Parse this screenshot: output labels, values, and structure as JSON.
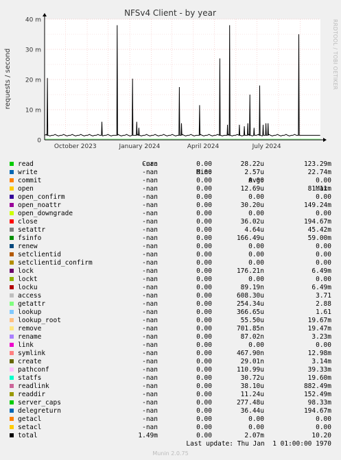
{
  "chart_data": {
    "type": "line",
    "title": "NFSv4 Client - by year",
    "ylabel": "requests / second",
    "ylim": [
      0,
      40
    ],
    "y_unit": "m",
    "yticks": [
      0,
      10,
      20,
      30,
      40
    ],
    "ytick_labels": [
      "0",
      "10 m",
      "20 m",
      "30 m",
      "40 m"
    ],
    "xlim": [
      "2023-09-01",
      "2024-09-30"
    ],
    "xtick_labels": [
      {
        "label": "October 2023",
        "date": "2023-10-15"
      },
      {
        "label": "January 2024",
        "date": "2024-01-15"
      },
      {
        "label": "April 2024",
        "date": "2024-04-15"
      },
      {
        "label": "July 2024",
        "date": "2024-07-15"
      }
    ],
    "grid": true,
    "series": [
      {
        "name": "total",
        "color": "#000000",
        "baseline": 1.5,
        "spikes": [
          {
            "x": "2023-09-05",
            "y": 20.5
          },
          {
            "x": "2023-11-22",
            "y": 6
          },
          {
            "x": "2023-12-14",
            "y": 38
          },
          {
            "x": "2024-01-05",
            "y": 20.3
          },
          {
            "x": "2024-01-11",
            "y": 6
          },
          {
            "x": "2024-01-14",
            "y": 4
          },
          {
            "x": "2024-03-12",
            "y": 17.5
          },
          {
            "x": "2024-03-15",
            "y": 5.5
          },
          {
            "x": "2024-04-10",
            "y": 11.5
          },
          {
            "x": "2024-05-09",
            "y": 27
          },
          {
            "x": "2024-05-20",
            "y": 5
          },
          {
            "x": "2024-05-23",
            "y": 38
          },
          {
            "x": "2024-06-06",
            "y": 5
          },
          {
            "x": "2024-06-13",
            "y": 4.5
          },
          {
            "x": "2024-06-18",
            "y": 5.5
          },
          {
            "x": "2024-06-21",
            "y": 15
          },
          {
            "x": "2024-06-27",
            "y": 4
          },
          {
            "x": "2024-07-05",
            "y": 18
          },
          {
            "x": "2024-07-10",
            "y": 5
          },
          {
            "x": "2024-07-14",
            "y": 5.5
          },
          {
            "x": "2024-07-17",
            "y": 5.5
          },
          {
            "x": "2024-08-30",
            "y": 35
          }
        ]
      }
    ]
  },
  "legend": {
    "headers": {
      "cur": "Cur:",
      "min": "Min:",
      "avg": "Avg:",
      "max": "Max:"
    },
    "rows": [
      {
        "name": "read",
        "color": "#00cc00",
        "cur": "-nan",
        "min": "0.00",
        "avg": "28.22u",
        "max": "123.29m"
      },
      {
        "name": "write",
        "color": "#0066b3",
        "cur": "-nan",
        "min": "0.00",
        "avg": "2.57u",
        "max": "22.74m"
      },
      {
        "name": "commit",
        "color": "#ff8000",
        "cur": "-nan",
        "min": "0.00",
        "avg": "0.00",
        "max": "0.00"
      },
      {
        "name": "open",
        "color": "#ffcc00",
        "cur": "-nan",
        "min": "0.00",
        "avg": "12.69u",
        "max": "81.11m"
      },
      {
        "name": "open_confirm",
        "color": "#330099",
        "cur": "-nan",
        "min": "0.00",
        "avg": "0.00",
        "max": "0.00"
      },
      {
        "name": "open_noattr",
        "color": "#990099",
        "cur": "-nan",
        "min": "0.00",
        "avg": "30.20u",
        "max": "149.24m"
      },
      {
        "name": "open_downgrade",
        "color": "#ccff00",
        "cur": "-nan",
        "min": "0.00",
        "avg": "0.00",
        "max": "0.00"
      },
      {
        "name": "close",
        "color": "#ff0000",
        "cur": "-nan",
        "min": "0.00",
        "avg": "36.02u",
        "max": "194.67m"
      },
      {
        "name": "setattr",
        "color": "#808080",
        "cur": "-nan",
        "min": "0.00",
        "avg": "4.64u",
        "max": "45.42m"
      },
      {
        "name": "fsinfo",
        "color": "#008f00",
        "cur": "-nan",
        "min": "0.00",
        "avg": "166.49u",
        "max": "59.00m"
      },
      {
        "name": "renew",
        "color": "#00487d",
        "cur": "-nan",
        "min": "0.00",
        "avg": "0.00",
        "max": "0.00"
      },
      {
        "name": "setclientid",
        "color": "#b35a00",
        "cur": "-nan",
        "min": "0.00",
        "avg": "0.00",
        "max": "0.00"
      },
      {
        "name": "setclientid_confirm",
        "color": "#b38f00",
        "cur": "-nan",
        "min": "0.00",
        "avg": "0.00",
        "max": "0.00"
      },
      {
        "name": "lock",
        "color": "#6b006b",
        "cur": "-nan",
        "min": "0.00",
        "avg": "176.21n",
        "max": "6.49m"
      },
      {
        "name": "lockt",
        "color": "#8fb300",
        "cur": "-nan",
        "min": "0.00",
        "avg": "0.00",
        "max": "0.00"
      },
      {
        "name": "locku",
        "color": "#b30000",
        "cur": "-nan",
        "min": "0.00",
        "avg": "89.19n",
        "max": "6.49m"
      },
      {
        "name": "access",
        "color": "#bebebe",
        "cur": "-nan",
        "min": "0.00",
        "avg": "608.30u",
        "max": "3.71"
      },
      {
        "name": "getattr",
        "color": "#80ff80",
        "cur": "-nan",
        "min": "0.00",
        "avg": "254.34u",
        "max": "2.88"
      },
      {
        "name": "lookup",
        "color": "#80c9ff",
        "cur": "-nan",
        "min": "0.00",
        "avg": "366.65u",
        "max": "1.61"
      },
      {
        "name": "lookup_root",
        "color": "#ffc080",
        "cur": "-nan",
        "min": "0.00",
        "avg": "55.50u",
        "max": "19.67m"
      },
      {
        "name": "remove",
        "color": "#ffe680",
        "cur": "-nan",
        "min": "0.00",
        "avg": "701.85n",
        "max": "19.47m"
      },
      {
        "name": "rename",
        "color": "#aa80ff",
        "cur": "-nan",
        "min": "0.00",
        "avg": "87.02n",
        "max": "3.23m"
      },
      {
        "name": "link",
        "color": "#ee00cc",
        "cur": "-nan",
        "min": "0.00",
        "avg": "0.00",
        "max": "0.00"
      },
      {
        "name": "symlink",
        "color": "#ff8080",
        "cur": "-nan",
        "min": "0.00",
        "avg": "467.90n",
        "max": "12.98m"
      },
      {
        "name": "create",
        "color": "#666600",
        "cur": "-nan",
        "min": "0.00",
        "avg": "29.01n",
        "max": "3.14m"
      },
      {
        "name": "pathconf",
        "color": "#ffbfff",
        "cur": "-nan",
        "min": "0.00",
        "avg": "110.99u",
        "max": "39.33m"
      },
      {
        "name": "statfs",
        "color": "#00ffcc",
        "cur": "-nan",
        "min": "0.00",
        "avg": "30.72u",
        "max": "19.60m"
      },
      {
        "name": "readlink",
        "color": "#cc6699",
        "cur": "-nan",
        "min": "0.00",
        "avg": "38.10u",
        "max": "882.49m"
      },
      {
        "name": "readdir",
        "color": "#999900",
        "cur": "-nan",
        "min": "0.00",
        "avg": "11.24u",
        "max": "152.49m"
      },
      {
        "name": "server_caps",
        "color": "#00cc00",
        "cur": "-nan",
        "min": "0.00",
        "avg": "277.48u",
        "max": "98.33m"
      },
      {
        "name": "delegreturn",
        "color": "#0066b3",
        "cur": "-nan",
        "min": "0.00",
        "avg": "36.44u",
        "max": "194.67m"
      },
      {
        "name": "getacl",
        "color": "#ff8000",
        "cur": "-nan",
        "min": "0.00",
        "avg": "0.00",
        "max": "0.00"
      },
      {
        "name": "setacl",
        "color": "#ffcc00",
        "cur": "-nan",
        "min": "0.00",
        "avg": "0.00",
        "max": "0.00"
      },
      {
        "name": "total",
        "color": "#000000",
        "cur": "1.49m",
        "min": "0.00",
        "avg": "2.07m",
        "max": "10.20"
      }
    ]
  },
  "footer": {
    "last_update": "Last update: Thu Jan  1 01:00:00 1970",
    "munin": "Munin 2.0.75",
    "rrdtool": "RRDTOOL / TOBI OETIKER"
  }
}
